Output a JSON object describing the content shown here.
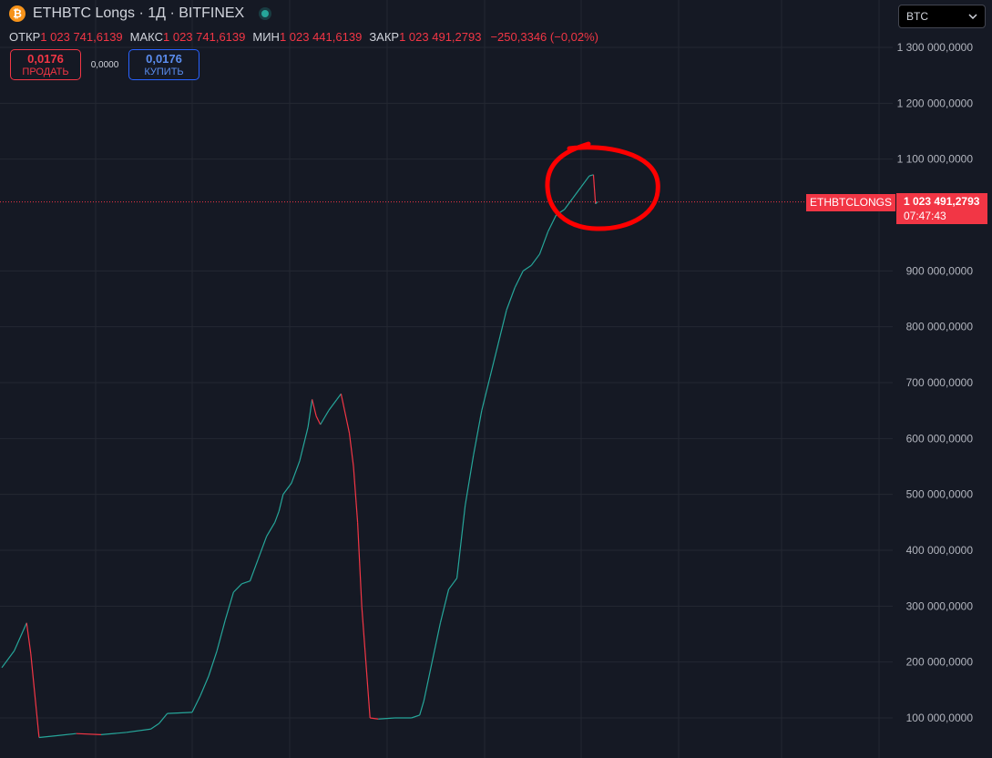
{
  "header": {
    "icon": "bitcoin-icon",
    "symbol_title": "ETHBTC Longs · 1Д · BITFINEX"
  },
  "ohlc": {
    "open_label": "ОТКР",
    "open": "1 023 741,6139",
    "high_label": "МАКС",
    "high": "1 023 741,6139",
    "low_label": "МИН",
    "low": "1 023 441,6139",
    "close_label": "ЗАКР",
    "close": "1 023 491,2793",
    "change": "−250,3346 (−0,02%)"
  },
  "trade": {
    "sell_price": "0,0176",
    "sell_label": "ПРОДАТЬ",
    "spread": "0,0000",
    "buy_price": "0,0176",
    "buy_label": "КУПИТЬ"
  },
  "currency_select": {
    "value": "BTC"
  },
  "last_price": {
    "symbol": "ETHBTCLONGS",
    "value": "1 023 491,2793",
    "countdown": "07:47:43"
  },
  "colors": {
    "background": "#151924",
    "up": "#26a69a",
    "down": "#f23645",
    "grid": "#242832",
    "annotation": "#ff0000"
  },
  "chart_data": {
    "type": "line",
    "title": "ETHBTC Longs",
    "interval": "1Д",
    "exchange": "BITFINEX",
    "y_axis_side": "right",
    "grid": true,
    "ylim": [
      50000000,
      1330000000
    ],
    "y_ticks": [
      100000000,
      200000000,
      300000000,
      400000000,
      500000000,
      600000000,
      700000000,
      800000000,
      900000000,
      1100000000,
      1200000000,
      1300000000
    ],
    "y_tick_labels": [
      "100 000,0000",
      "200 000,0000",
      "300 000,0000",
      "400 000,0000",
      "500 000,0000",
      "600 000,0000",
      "700 000,0000",
      "800 000,0000",
      "900 000,0000",
      "1 100 000,0000",
      "1 200 000,0000",
      "1 300 000,0000"
    ],
    "x_range": [
      0,
      160
    ],
    "series": [
      {
        "values": [
          [
            0,
            190000000
          ],
          [
            3,
            220000000
          ],
          [
            6,
            270000000
          ],
          [
            7,
            215000000
          ],
          [
            9,
            65000000
          ],
          [
            13,
            68000000
          ],
          [
            18,
            72000000
          ],
          [
            24,
            70000000
          ],
          [
            30,
            74000000
          ],
          [
            36,
            80000000
          ],
          [
            38,
            90000000
          ],
          [
            40,
            108000000
          ],
          [
            46,
            110000000
          ],
          [
            48,
            140000000
          ],
          [
            50,
            175000000
          ],
          [
            52,
            220000000
          ],
          [
            54,
            275000000
          ],
          [
            56,
            325000000
          ],
          [
            58,
            340000000
          ],
          [
            60,
            345000000
          ],
          [
            62,
            385000000
          ],
          [
            64,
            425000000
          ],
          [
            66,
            450000000
          ],
          [
            67,
            470000000
          ],
          [
            68,
            500000000
          ],
          [
            70,
            520000000
          ],
          [
            72,
            560000000
          ],
          [
            74,
            620000000
          ],
          [
            75,
            670000000
          ],
          [
            76,
            640000000
          ],
          [
            77,
            625000000
          ],
          [
            79,
            650000000
          ],
          [
            81,
            670000000
          ],
          [
            82,
            680000000
          ],
          [
            84,
            610000000
          ],
          [
            85,
            550000000
          ],
          [
            86,
            450000000
          ],
          [
            87,
            300000000
          ],
          [
            88,
            200000000
          ],
          [
            89,
            100000000
          ],
          [
            91,
            98000000
          ],
          [
            95,
            100000000
          ],
          [
            99,
            100000000
          ],
          [
            101,
            105000000
          ],
          [
            102,
            130000000
          ],
          [
            104,
            200000000
          ],
          [
            106,
            270000000
          ],
          [
            108,
            330000000
          ],
          [
            110,
            350000000
          ],
          [
            112,
            480000000
          ],
          [
            114,
            570000000
          ],
          [
            116,
            650000000
          ],
          [
            118,
            710000000
          ],
          [
            120,
            770000000
          ],
          [
            122,
            830000000
          ],
          [
            124,
            870000000
          ],
          [
            126,
            900000000
          ],
          [
            128,
            910000000
          ],
          [
            130,
            930000000
          ],
          [
            132,
            970000000
          ],
          [
            134,
            1000000000
          ],
          [
            136,
            1010000000
          ],
          [
            138,
            1030000000
          ],
          [
            140,
            1050000000
          ],
          [
            142,
            1070000000
          ],
          [
            143,
            1072000000
          ],
          [
            143.5,
            1020000000
          ],
          [
            144,
            1023491.2793
          ]
        ]
      }
    ],
    "last_value": 1023491279.3
  }
}
